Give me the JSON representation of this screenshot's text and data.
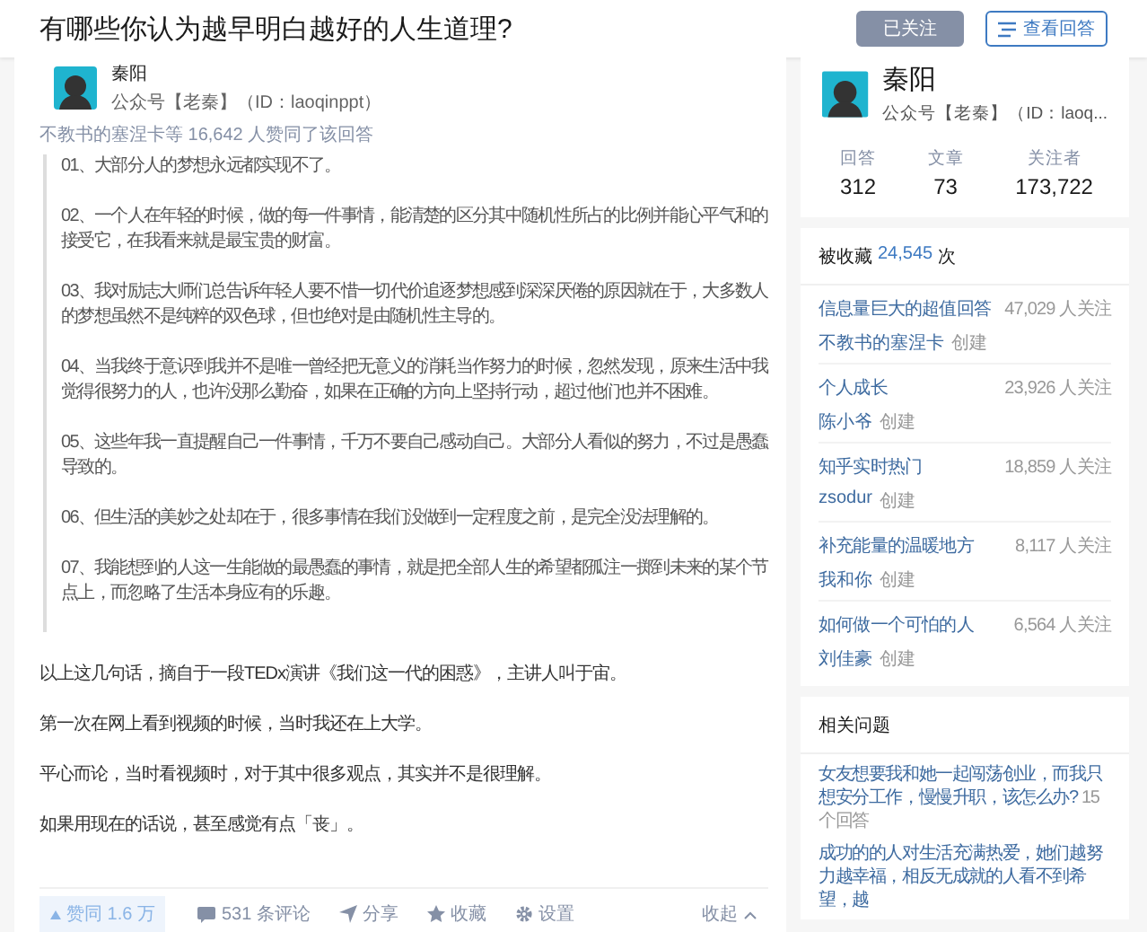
{
  "header": {
    "title": "有哪些你认为越早明白越好的人生道理?",
    "buttons": [
      {
        "label": "已关注",
        "kind": "filled"
      },
      {
        "label": "查看回答",
        "kind": "outline"
      }
    ]
  },
  "answer": {
    "author": {
      "name": "秦阳",
      "bio": "公众号【老秦】（ID：laoqinppt）"
    },
    "votes_line": "不教书的塞涅卡等 16,642 人赞同了该回答",
    "quote": [
      "01、大部分人的梦想永远都实现不了。",
      "02、一个人在年轻的时候，做的每一件事情，能清楚的区分其中随机性所占的比例并能心平气和的接受它，在我看来就是最宝贵的财富。",
      "03、我对励志大师们总告诉年轻人要不惜一切代价追逐梦想感到深深厌倦的原因就在于，大多数人的梦想虽然不是纯粹的双色球，但也绝对是由随机性主导的。",
      "04、当我终于意识到我并不是唯一曾经把无意义的消耗当作努力的时候，忽然发现，原来生活中我觉得很努力的人，也许没那么勤奋，如果在正确的方向上坚持行动，超过他们也并不困难。",
      "05、这些年我一直提醒自己一件事情，千万不要自己感动自己。大部分人看似的努力，不过是愚蠢导致的。",
      "06、但生活的美妙之处却在于，很多事情在我们没做到一定程度之前，是完全没法理解的。",
      "07、我能想到的人这一生能做的最愚蠢的事情，就是把全部人生的希望都孤注一掷到未来的某个节点上，而忽略了生活本身应有的乐趣。"
    ],
    "paragraphs": [
      "以上这几句话，摘自于一段TEDx演讲《我们这一代的困惑》，主讲人叫于宙。",
      "第一次在网上看到视频的时候，当时我还在上大学。",
      "平心而论，当时看视频时，对于其中很多观点，其实并不是很理解。",
      "如果用现在的话说，甚至感觉有点「丧」。"
    ],
    "actions": [
      {
        "kind": "vote",
        "label": "赞同 1.6 万"
      },
      {
        "kind": "comment",
        "label": "531 条评论"
      },
      {
        "kind": "share",
        "label": "分享"
      },
      {
        "kind": "star",
        "label": "收藏"
      },
      {
        "kind": "gear",
        "label": "设置"
      },
      {
        "kind": "collapse",
        "label": "收起"
      }
    ]
  },
  "profile": {
    "name": "秦阳",
    "bio": "公众号【老秦】（ID：laoq...",
    "stats": [
      {
        "label": "回答",
        "value": "312"
      },
      {
        "label": "文章",
        "value": "73"
      },
      {
        "label": "关注者",
        "value": "173,722"
      }
    ]
  },
  "collections": {
    "heading": "被收藏",
    "count": "24,545",
    "unit": "次",
    "items": [
      {
        "title": "信息量巨大的超值回答",
        "followers": "47,029 人关注",
        "creator": "不教书的塞涅卡",
        "created": "创建"
      },
      {
        "title": "个人成长",
        "followers": "23,926 人关注",
        "creator": "陈小爷",
        "created": "创建"
      },
      {
        "title": "知乎实时热门",
        "followers": "18,859 人关注",
        "creator": "zsodur",
        "created": "创建"
      },
      {
        "title": "补充能量的温暖地方",
        "followers": "8,117 人关注",
        "creator": "我和你",
        "created": "创建"
      },
      {
        "title": "如何做一个可怕的人",
        "followers": "6,564 人关注",
        "creator": "刘佳豪",
        "created": "创建"
      }
    ]
  },
  "related": {
    "heading": "相关问题",
    "questions": [
      {
        "text": "女友想要我和她一起闯荡创业，而我只想安分工作，慢慢升职，该怎么办?",
        "answers": "15 个回答"
      },
      {
        "text": "成功的的人对生活充满热爱，她们越努力越幸福，相反无成就的人看不到希望，越"
      }
    ]
  }
}
